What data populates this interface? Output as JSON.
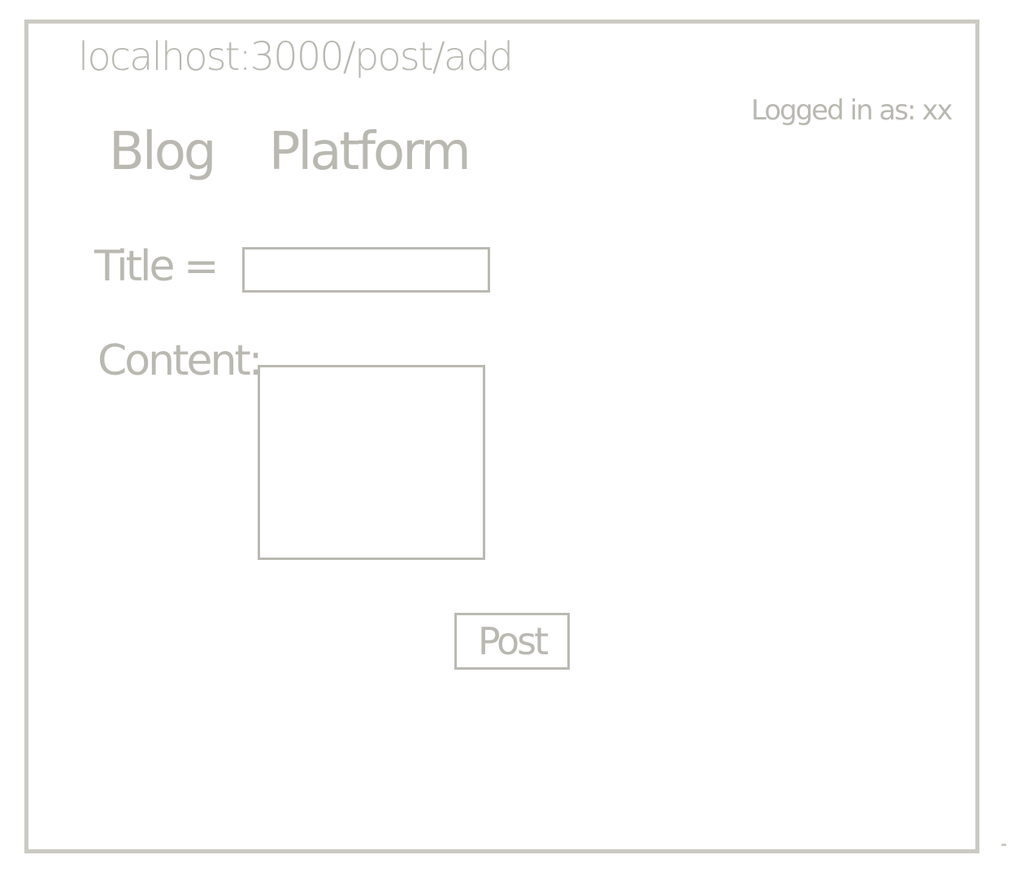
{
  "browser": {
    "url": "localhost:3000/post/add"
  },
  "header": {
    "login_status": "Logged in as: xx",
    "app_title": "Blog Platform"
  },
  "form": {
    "title_label": "Title =",
    "title_value": "",
    "content_label": "Content:",
    "content_value": "",
    "submit_label": "Post"
  },
  "colors": {
    "stroke": "#bab9b2",
    "frame": "#cbcac3",
    "background": "#ffffff"
  }
}
